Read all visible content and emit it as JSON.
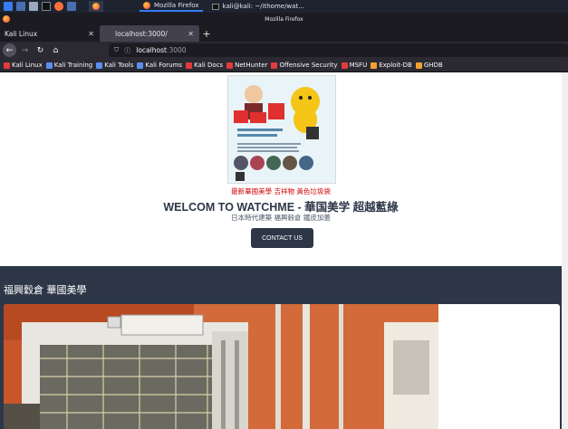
{
  "taskbar": {
    "tasks": [
      {
        "label": "Mozilla Firefox",
        "active": true
      },
      {
        "label": "kali@kali: ~/ithome/wat...",
        "active": false
      }
    ]
  },
  "window": {
    "title": "Mozilla Firefox"
  },
  "tabs": [
    {
      "label": "Kali Linux",
      "selected": false
    },
    {
      "label": "localhost:3000/",
      "selected": true
    }
  ],
  "navbar": {
    "url_host": "localhost",
    "url_rest": ":3000"
  },
  "bookmarks": [
    {
      "label": "Kali Linux",
      "icon": "kali-icon",
      "color": "#e23b3b"
    },
    {
      "label": "Kali Training",
      "icon": "kali-training-icon",
      "color": "#5b8ef0"
    },
    {
      "label": "Kali Tools",
      "icon": "kali-tools-icon",
      "color": "#5b8ef0"
    },
    {
      "label": "Kali Forums",
      "icon": "kali-forums-icon",
      "color": "#5b8ef0"
    },
    {
      "label": "Kali Docs",
      "icon": "kali-docs-icon",
      "color": "#e23b3b"
    },
    {
      "label": "NetHunter",
      "icon": "nethunter-icon",
      "color": "#e23b3b"
    },
    {
      "label": "Offensive Security",
      "icon": "offsec-icon",
      "color": "#e23b3b"
    },
    {
      "label": "MSFU",
      "icon": "msfu-icon",
      "color": "#e23b3b"
    },
    {
      "label": "Exploit-DB",
      "icon": "exploit-db-icon",
      "color": "#f0a030"
    },
    {
      "label": "GHDB",
      "icon": "ghdb-icon",
      "color": "#f0a030"
    }
  ],
  "page": {
    "caption": "最新華國美學 吉祥物 黃色垃圾袋",
    "title": "WELCOM TO WATCHME - 華国美学 超越藍綠",
    "subtitle": "日本時代建築 福興穀倉 鐵皮加蓋",
    "contact_button": "CONTACT US",
    "section_title": "福興穀倉 華國美學"
  },
  "colors": {
    "dark": "#2d3748",
    "accent_red": "#d00000"
  }
}
